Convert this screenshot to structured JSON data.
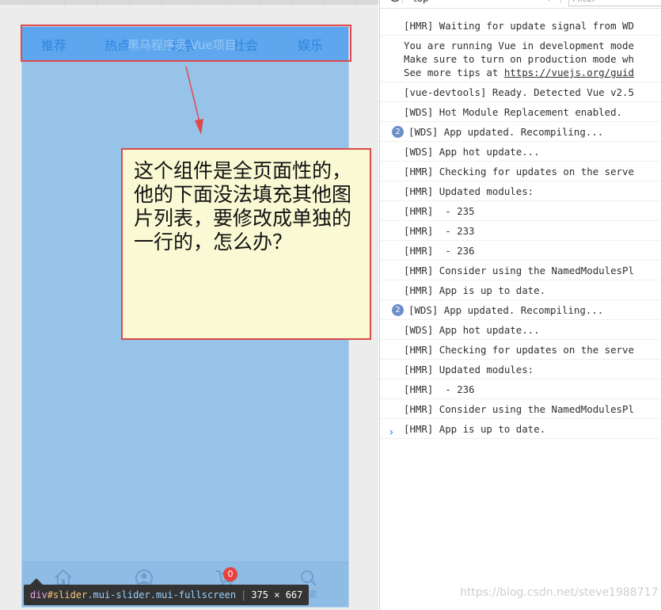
{
  "nav_tabs": [
    "推荐",
    "热点",
    "北京",
    "社会",
    "娱乐"
  ],
  "page_title_overlay": "黑马程序员 Vue项目",
  "tabbar": {
    "cart_badge": "0",
    "search_label": "搜索"
  },
  "element_tooltip": {
    "tag": "div",
    "id": "#slider",
    "classes": ".mui-slider.mui-fullscreen",
    "size": "375 × 667"
  },
  "callout_text": "这个组件是全页面性的，他的下面没法填充其他图片列表，要修改成单独的一行的，怎么办？",
  "console": {
    "context": "top",
    "filter_placeholder": "Filter",
    "logs": [
      {
        "lines": [
          "[HMR] Waiting for update signal from WD"
        ]
      },
      {
        "lines": [
          "You are running Vue in development mode",
          "Make sure to turn on production mode wh",
          "See more tips at "
        ],
        "link": "https://vuejs.org/guid"
      },
      {
        "lines": [
          "[vue-devtools] Ready. Detected Vue v2.5"
        ]
      },
      {
        "lines": [
          "[WDS] Hot Module Replacement enabled."
        ]
      },
      {
        "lines": [
          "[WDS] App updated. Recompiling..."
        ],
        "count": "2"
      },
      {
        "lines": [
          "[WDS] App hot update..."
        ]
      },
      {
        "lines": [
          "[HMR] Checking for updates on the serve"
        ]
      },
      {
        "lines": [
          "[HMR] Updated modules:"
        ]
      },
      {
        "lines": [
          "[HMR]  - 235"
        ]
      },
      {
        "lines": [
          "[HMR]  - 233"
        ]
      },
      {
        "lines": [
          "[HMR]  - 236"
        ]
      },
      {
        "lines": [
          "[HMR] Consider using the NamedModulesPl"
        ]
      },
      {
        "lines": [
          "[HMR] App is up to date."
        ]
      },
      {
        "lines": [
          "[WDS] App updated. Recompiling..."
        ],
        "count": "2"
      },
      {
        "lines": [
          "[WDS] App hot update..."
        ]
      },
      {
        "lines": [
          "[HMR] Checking for updates on the serve"
        ]
      },
      {
        "lines": [
          "[HMR] Updated modules:"
        ]
      },
      {
        "lines": [
          "[HMR]  - 236"
        ]
      },
      {
        "lines": [
          "[HMR] Consider using the NamedModulesPl"
        ]
      },
      {
        "lines": [
          "[HMR] App is up to date."
        ]
      }
    ],
    "prompt": "›"
  },
  "watermark": "https://blog.csdn.net/steve1988717",
  "colors": {
    "annotation_red": "#e0484b",
    "phone_bg": "#97c3e9",
    "nav_bg": "#5ea6ee"
  }
}
